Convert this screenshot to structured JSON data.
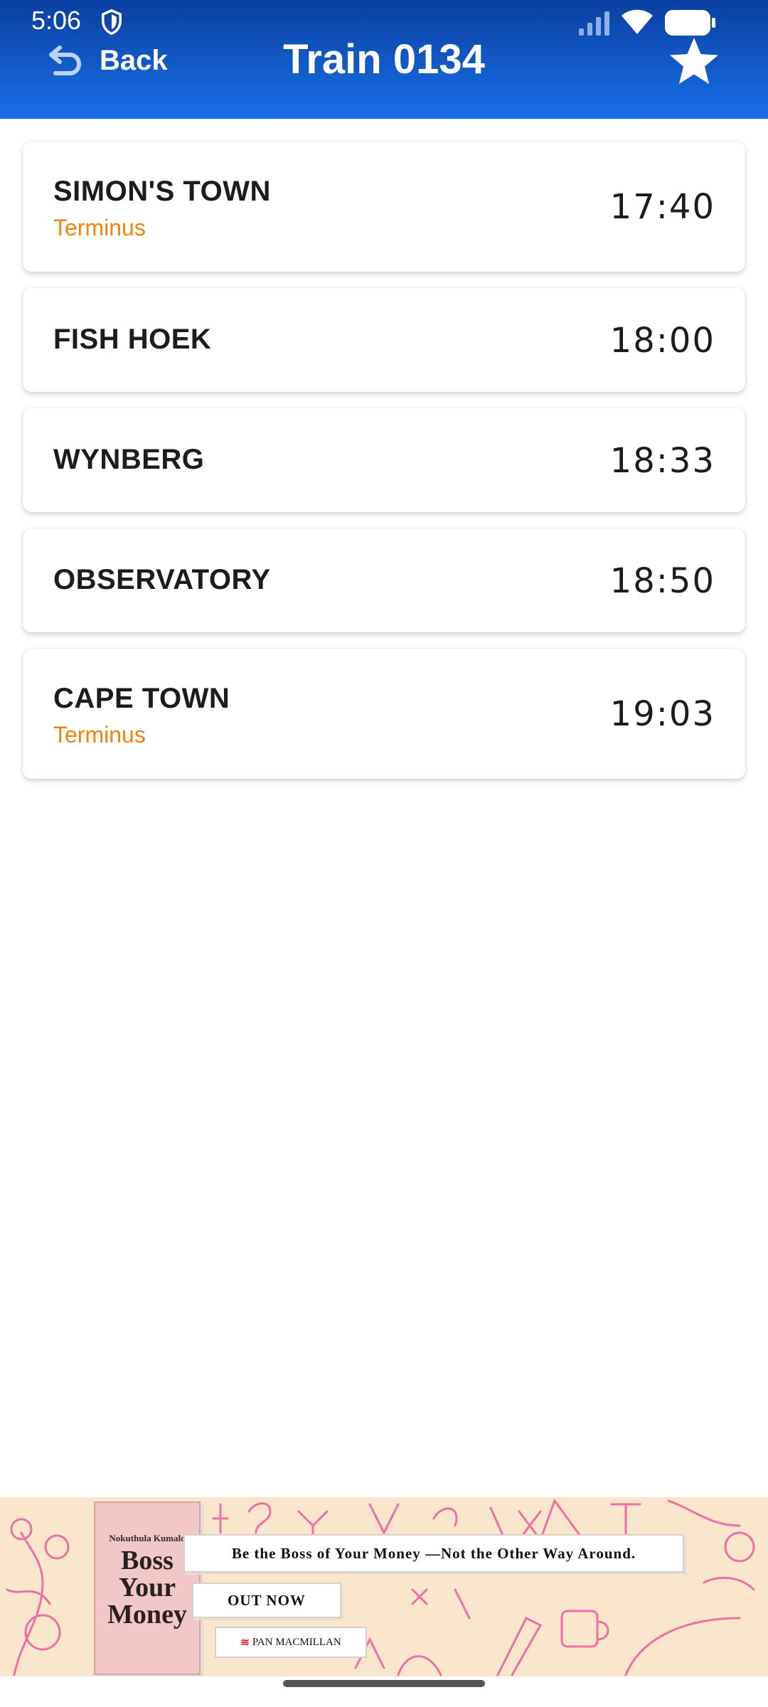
{
  "status_bar": {
    "time": "5:06",
    "icons": [
      "shield-icon",
      "signal-icon",
      "wifi-icon",
      "battery-icon"
    ]
  },
  "header": {
    "back_label": "Back",
    "title": "Train 0134",
    "favorite_icon": "star-icon"
  },
  "stops": [
    {
      "station": "SIMON'S TOWN",
      "note": "Terminus",
      "time": "17:40"
    },
    {
      "station": "FISH HOEK",
      "time": "18:00"
    },
    {
      "station": "WYNBERG",
      "time": "18:33"
    },
    {
      "station": "OBSERVATORY",
      "time": "18:50"
    },
    {
      "station": "CAPE TOWN",
      "note": "Terminus",
      "time": "19:03"
    }
  ],
  "ad": {
    "book_author": "Nokuthula Kumalo",
    "book_title": "Boss Your Money",
    "tagline": "Be the Boss of Your Money —Not the Other Way Around.",
    "cta": "OUT NOW",
    "publisher": "PAN MACMILLAN"
  },
  "colors": {
    "header_top": "#0a3fa0",
    "header_bottom": "#1a70e8",
    "accent_orange": "#f2820d",
    "ad_background": "#f9e6cc"
  }
}
